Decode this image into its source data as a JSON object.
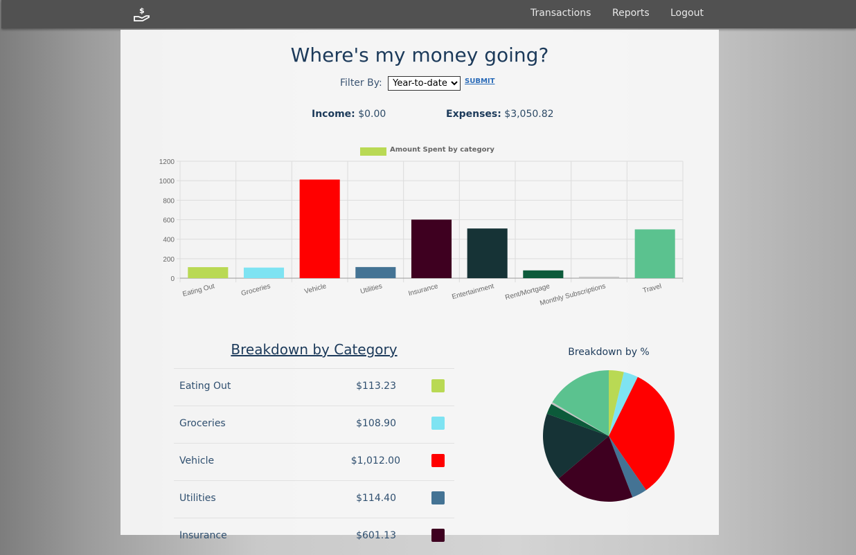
{
  "nav": {
    "links": [
      "Transactions",
      "Reports",
      "Logout"
    ]
  },
  "page": {
    "title": "Where's my money going?",
    "filter_label": "Filter By:",
    "filter_value": "Year-to-date",
    "submit_label": "SUBMIT",
    "income_label": "Income:",
    "income_value": "$0.00",
    "expenses_label": "Expenses:",
    "expenses_value": "$3,050.82"
  },
  "chart_data": [
    {
      "type": "bar",
      "legend": "Amount Spent by category",
      "legend_position": "top",
      "categories": [
        "Eating Out",
        "Groceries",
        "Vehicle",
        "Utilities",
        "Insurance",
        "Entertainment",
        "Rent/Mortgage",
        "Monthly Subscriptions",
        "Travel"
      ],
      "values": [
        113.23,
        108.9,
        1012.0,
        114.4,
        601.13,
        510,
        80,
        15,
        501
      ],
      "colors": [
        "#b9d954",
        "#7ee3f2",
        "#ff0000",
        "#447394",
        "#3e0020",
        "#163336",
        "#0c5a3a",
        "#c4c4c4",
        "#5bc28f"
      ],
      "ylim": [
        0,
        1200
      ],
      "yticks": [
        "0",
        "200",
        "400",
        "600",
        "800",
        "1000",
        "1200"
      ],
      "grid": true
    },
    {
      "type": "pie",
      "title": "Breakdown by %",
      "categories": [
        "Eating Out",
        "Groceries",
        "Vehicle",
        "Utilities",
        "Insurance",
        "Entertainment",
        "Rent/Mortgage",
        "Monthly Subscriptions",
        "Travel"
      ],
      "values": [
        113.23,
        108.9,
        1012.0,
        114.4,
        601.13,
        510,
        80,
        15,
        501
      ],
      "colors": [
        "#b9d954",
        "#7ee3f2",
        "#ff0000",
        "#447394",
        "#3e0020",
        "#163336",
        "#0c5a3a",
        "#c4c4c4",
        "#5bc28f"
      ]
    }
  ],
  "breakdown": {
    "title": "Breakdown by Category",
    "rows": [
      {
        "name": "Eating Out",
        "amount": "$113.23",
        "color": "#b9d954"
      },
      {
        "name": "Groceries",
        "amount": "$108.90",
        "color": "#7ee3f2"
      },
      {
        "name": "Vehicle",
        "amount": "$1,012.00",
        "color": "#ff0000"
      },
      {
        "name": "Utilities",
        "amount": "$114.40",
        "color": "#447394"
      },
      {
        "name": "Insurance",
        "amount": "$601.13",
        "color": "#3e0020"
      }
    ]
  }
}
